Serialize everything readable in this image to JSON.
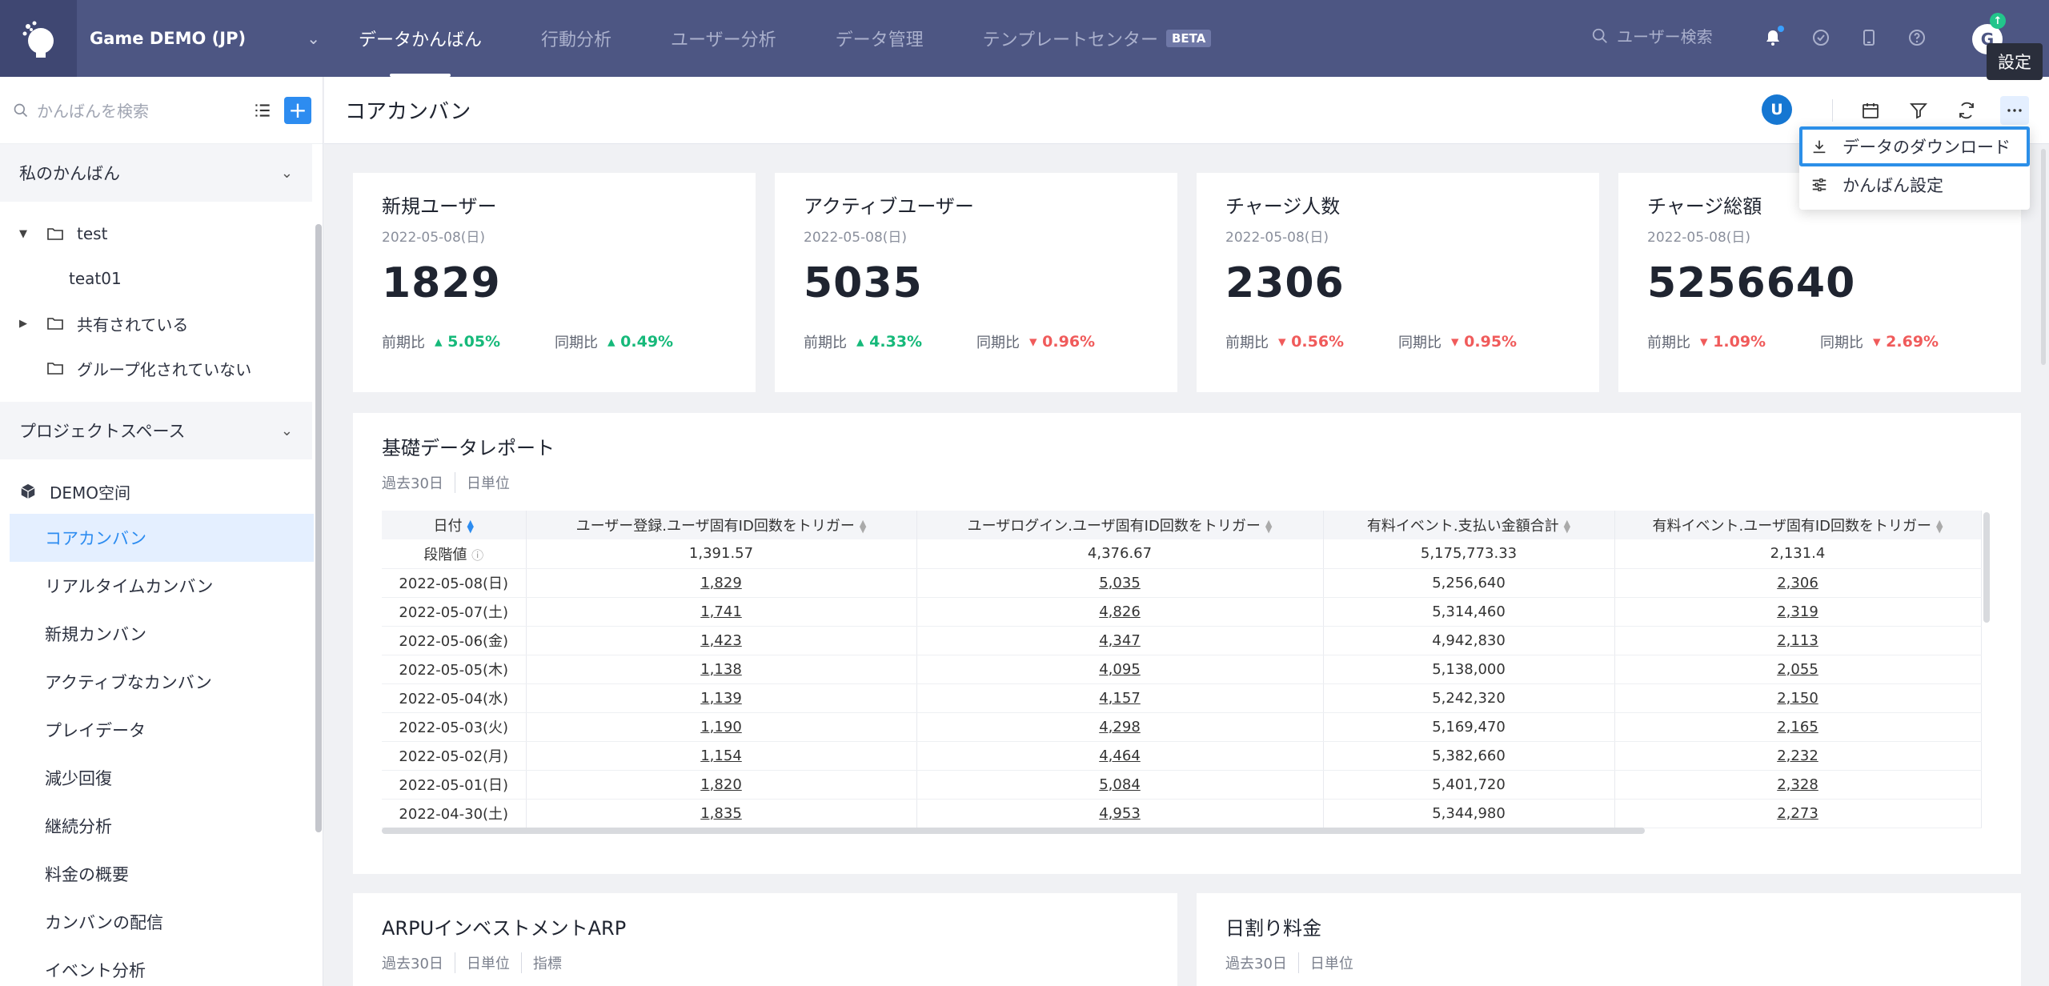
{
  "topbar": {
    "project_name": "Game DEMO (JP)",
    "nav": [
      {
        "label": "データかんばん",
        "active": true
      },
      {
        "label": "行動分析",
        "active": false
      },
      {
        "label": "ユーザー分析",
        "active": false
      },
      {
        "label": "データ管理",
        "active": false
      },
      {
        "label": "テンプレートセンター",
        "active": false
      }
    ],
    "beta_label": "BETA",
    "search_placeholder": "ユーザー検索",
    "avatar_letter": "G",
    "avatar_badge": "↑",
    "tooltip": "設定"
  },
  "sidebar": {
    "search_placeholder": "かんばんを検索",
    "add_label": "+",
    "my_section": "私のかんばん",
    "tree": {
      "folder_test": "test",
      "item_teat01": "teat01",
      "folder_shared": "共有されている",
      "folder_ungrouped": "グループ化されていない"
    },
    "project_section": "プロジェクトスペース",
    "space_name": "DEMO空间",
    "items": [
      {
        "label": "コアカンバン",
        "active": true
      },
      {
        "label": "リアルタイムカンバン"
      },
      {
        "label": "新規カンバン"
      },
      {
        "label": "アクティブなカンバン"
      },
      {
        "label": "プレイデータ"
      },
      {
        "label": "減少回復"
      },
      {
        "label": "継続分析"
      },
      {
        "label": "料金の概要"
      },
      {
        "label": "カンバンの配信"
      },
      {
        "label": "イベント分析"
      }
    ]
  },
  "header": {
    "title": "コアカンバン",
    "user_letter": "U"
  },
  "menu": {
    "download": "データのダウンロード",
    "settings": "かんばん設定"
  },
  "kpis": [
    {
      "title": "新規ユーザー",
      "date": "2022-05-08(日)",
      "value": "1829",
      "prev_label": "前期比",
      "prev_pct": "5.05%",
      "prev_dir": "up",
      "same_label": "同期比",
      "same_pct": "0.49%",
      "same_dir": "up"
    },
    {
      "title": "アクティブユーザー",
      "date": "2022-05-08(日)",
      "value": "5035",
      "prev_label": "前期比",
      "prev_pct": "4.33%",
      "prev_dir": "up",
      "same_label": "同期比",
      "same_pct": "0.96%",
      "same_dir": "down"
    },
    {
      "title": "チャージ人数",
      "date": "2022-05-08(日)",
      "value": "2306",
      "prev_label": "前期比",
      "prev_pct": "0.56%",
      "prev_dir": "down",
      "same_label": "同期比",
      "same_pct": "0.95%",
      "same_dir": "down"
    },
    {
      "title": "チャージ総額",
      "date": "2022-05-08(日)",
      "value": "5256640",
      "prev_label": "前期比",
      "prev_pct": "1.09%",
      "prev_dir": "down",
      "same_label": "同期比",
      "same_pct": "2.69%",
      "same_dir": "down"
    }
  ],
  "report": {
    "title": "基礎データレポート",
    "range": "過去30日",
    "unit": "日単位",
    "columns": [
      "日付",
      "ユーザー登録.ユーザ固有ID回数をトリガー",
      "ユーザログイン.ユーザ固有ID回数をトリガー",
      "有料イベント.支払い金額合計",
      "有料イベント.ユーザ固有ID回数をトリガー"
    ],
    "summary_label": "段階値",
    "summary": [
      "1,391.57",
      "4,376.67",
      "5,175,773.33",
      "2,131.4"
    ],
    "rows": [
      [
        "2022-05-08(日)",
        "1,829",
        "5,035",
        "5,256,640",
        "2,306"
      ],
      [
        "2022-05-07(土)",
        "1,741",
        "4,826",
        "5,314,460",
        "2,319"
      ],
      [
        "2022-05-06(金)",
        "1,423",
        "4,347",
        "4,942,830",
        "2,113"
      ],
      [
        "2022-05-05(木)",
        "1,138",
        "4,095",
        "5,138,000",
        "2,055"
      ],
      [
        "2022-05-04(水)",
        "1,139",
        "4,157",
        "5,242,320",
        "2,150"
      ],
      [
        "2022-05-03(火)",
        "1,190",
        "4,298",
        "5,169,470",
        "2,165"
      ],
      [
        "2022-05-02(月)",
        "1,154",
        "4,464",
        "5,382,660",
        "2,232"
      ],
      [
        "2022-05-01(日)",
        "1,820",
        "5,084",
        "5,401,720",
        "2,328"
      ],
      [
        "2022-04-30(土)",
        "1,835",
        "4,953",
        "5,344,980",
        "2,273"
      ]
    ]
  },
  "arpu": {
    "title": "ARPUインベストメントARP",
    "range": "過去30日",
    "unit": "日単位",
    "metric": "指標"
  },
  "daily": {
    "title": "日割り料金",
    "range": "過去30日",
    "unit": "日単位"
  },
  "colors": {
    "topbar": "#4d5683",
    "accent": "#2d8cf0",
    "up": "#16b97a",
    "down": "#f05b5b"
  }
}
